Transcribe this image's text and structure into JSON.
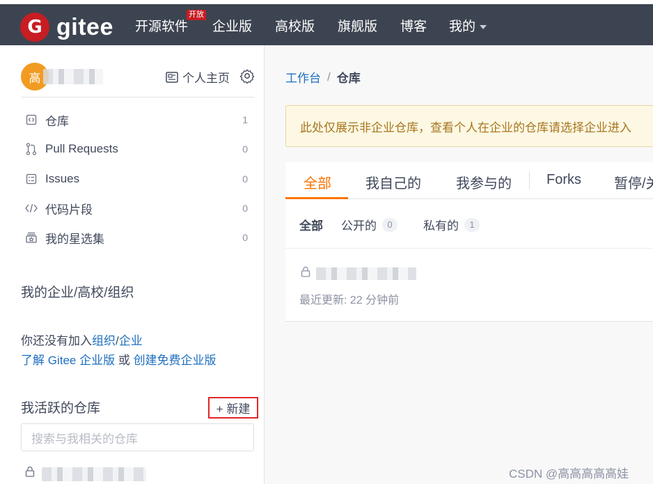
{
  "topbar": {
    "logo_letter": "G",
    "logo_text": "gitee",
    "nav": [
      {
        "label": "开源软件"
      },
      {
        "label": "企业版"
      },
      {
        "label": "高校版"
      },
      {
        "label": "旗舰版"
      },
      {
        "label": "博客"
      },
      {
        "label": "我的"
      }
    ],
    "open_badge": "开放"
  },
  "sidebar": {
    "avatar_text": "高",
    "home_link": "个人主页",
    "menu": [
      {
        "label": "仓库",
        "count": "1",
        "icon": "repo-icon"
      },
      {
        "label": "Pull Requests",
        "count": "0",
        "icon": "pull-request-icon"
      },
      {
        "label": "Issues",
        "count": "0",
        "icon": "issues-icon"
      },
      {
        "label": "代码片段",
        "count": "0",
        "icon": "code-icon"
      },
      {
        "label": "我的星选集",
        "count": "0",
        "icon": "collection-icon"
      }
    ],
    "org_title": "我的企业/高校/组织",
    "org_text_1": "你还没有加入",
    "org_link_org": "组织",
    "org_slash": "/",
    "org_link_ent": "企业",
    "org_link_learn": "了解 Gitee 企业版",
    "org_or": "或",
    "org_link_create": "创建免费企业版",
    "active_title": "我活跃的仓库",
    "new_button": "+ 新建",
    "search_placeholder": "搜索与我相关的仓库"
  },
  "main": {
    "breadcrumb_root": "工作台",
    "breadcrumb_sep": "/",
    "breadcrumb_current": "仓库",
    "notice": "此处仅展示非企业仓库，查看个人在企业的仓库请选择企业进入",
    "tabs": [
      "全部",
      "我自己的",
      "我参与的",
      "Forks",
      "暂停/关"
    ],
    "filters": [
      {
        "label": "全部",
        "count": null
      },
      {
        "label": "公开的",
        "count": "0"
      },
      {
        "label": "私有的",
        "count": "1"
      }
    ],
    "repo_updated": "最近更新: 22 分钟前"
  },
  "watermark": "CSDN @高高高高高娃",
  "colors": {
    "topbar": "#3d4451",
    "brand": "#c71d23",
    "accent": "#fe7300",
    "link": "#1e6fbf"
  }
}
